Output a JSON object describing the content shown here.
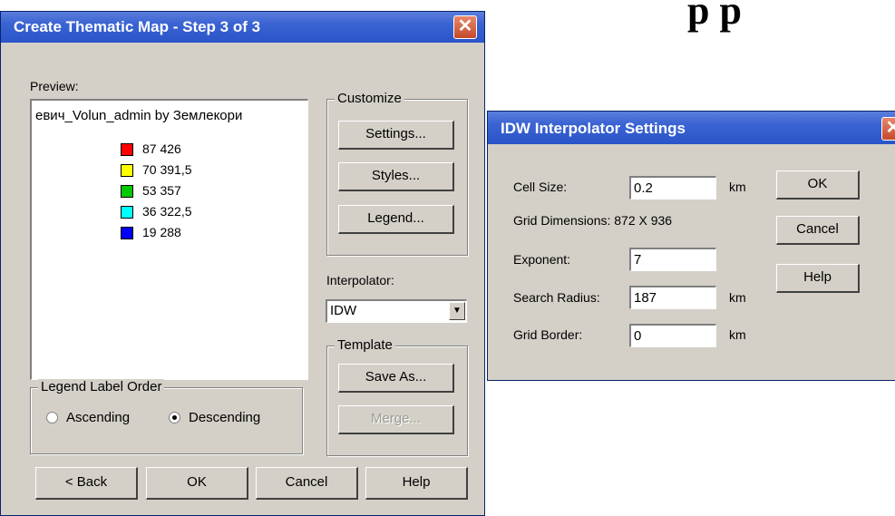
{
  "background": {
    "title_fragment": "р р"
  },
  "thematic_dialog": {
    "title": "Create Thematic Map - Step 3 of 3",
    "close_glyph": "✕",
    "preview_label": "Preview:",
    "preview": {
      "title": "евич_Volun_admin by Землекори",
      "legend": [
        {
          "value": "87 426",
          "color": "#ff0000"
        },
        {
          "value": "70 391,5",
          "color": "#ffff00"
        },
        {
          "value": "53 357",
          "color": "#00c800"
        },
        {
          "value": "36 322,5",
          "color": "#00ffff"
        },
        {
          "value": "19 288",
          "color": "#0000ff"
        }
      ]
    },
    "customize": {
      "title": "Customize",
      "settings": "Settings...",
      "styles": "Styles...",
      "legend": "Legend..."
    },
    "interpolator": {
      "label": "Interpolator:",
      "value": "IDW"
    },
    "template": {
      "title": "Template",
      "save_as": "Save As...",
      "merge": "Merge..."
    },
    "legend_order": {
      "title": "Legend Label Order",
      "ascending": "Ascending",
      "descending": "Descending",
      "selected": "descending"
    },
    "buttons": {
      "back": "< Back",
      "ok": "OK",
      "cancel": "Cancel",
      "help": "Help"
    }
  },
  "idw_dialog": {
    "title": "IDW Interpolator Settings",
    "close_glyph": "✕",
    "cell_size": {
      "label": "Cell Size:",
      "value": "0.2",
      "unit": "km"
    },
    "grid_dimensions": {
      "label": "Grid Dimensions: 872 X 936"
    },
    "exponent": {
      "label": "Exponent:",
      "value": "7"
    },
    "search_radius": {
      "label": "Search Radius:",
      "value": "187",
      "unit": "km"
    },
    "grid_border": {
      "label": "Grid Border:",
      "value": "0",
      "unit": "km"
    },
    "buttons": {
      "ok": "OK",
      "cancel": "Cancel",
      "help": "Help"
    }
  }
}
